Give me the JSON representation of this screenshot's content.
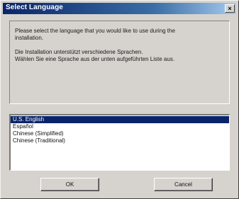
{
  "window": {
    "title": "Select Language",
    "close_glyph": "×"
  },
  "message": {
    "line1": "Please select the language that you would like to use during the",
    "line2": "installation.",
    "line3": "Die Installation unterstützt verschiedene Sprachen.",
    "line4": "Wählen Sie eine Sprache aus der unten aufgeführten Liste aus."
  },
  "languages": {
    "items": [
      "U.S. English",
      "Español",
      "Chinese (Simplified)",
      "Chinese (Traditional)"
    ],
    "selected": "U.S. English"
  },
  "buttons": {
    "ok": "OK",
    "cancel": "Cancel"
  },
  "colors": {
    "dialog_face": "#d6d3ce",
    "title_gradient_start": "#0a246a",
    "title_gradient_end": "#a6caf0",
    "selection": "#0a246a"
  },
  "icons": {
    "close": "close-icon"
  }
}
